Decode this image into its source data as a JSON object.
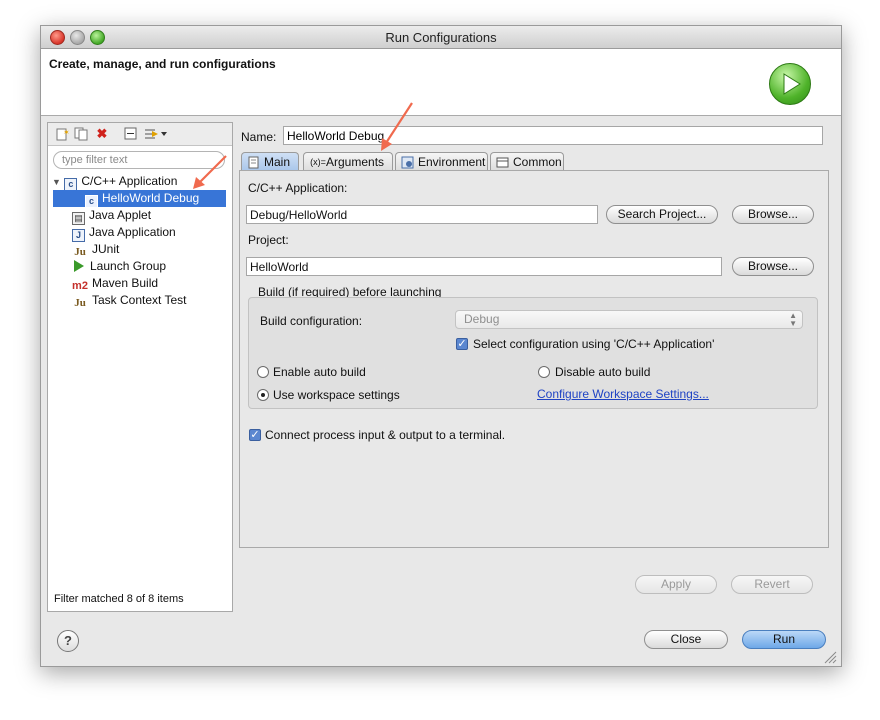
{
  "window": {
    "title": "Run Configurations"
  },
  "header": {
    "text": "Create, manage, and run configurations"
  },
  "left": {
    "filter_placeholder": "type filter text",
    "tree": [
      {
        "label": "C/C++ Application",
        "icon": "c-app-icon"
      },
      {
        "label": "HelloWorld Debug",
        "icon": "c-config-icon",
        "selected": true
      },
      {
        "label": "Java Applet",
        "icon": "java-applet-icon"
      },
      {
        "label": "Java Application",
        "icon": "java-app-icon"
      },
      {
        "label": "JUnit",
        "icon": "junit-icon"
      },
      {
        "label": "Launch Group",
        "icon": "launch-group-icon"
      },
      {
        "label": "Maven Build",
        "icon": "maven-icon"
      },
      {
        "label": "Task Context Test",
        "icon": "task-context-icon"
      }
    ],
    "footer": "Filter matched 8 of 8 items"
  },
  "config": {
    "name_label": "Name:",
    "name_value": "HelloWorld Debug",
    "tabs": [
      {
        "label": "Main",
        "active": true
      },
      {
        "label": "Arguments"
      },
      {
        "label": "Environment"
      },
      {
        "label": "Common"
      }
    ],
    "app_label": "C/C++ Application:",
    "app_value": "Debug/HelloWorld",
    "search_project": "Search Project...",
    "browse": "Browse...",
    "project_label": "Project:",
    "project_value": "HelloWorld",
    "build_group_label": "Build (if required) before launching",
    "build_config_label": "Build configuration:",
    "build_config_value": "Debug",
    "select_config_label": "Select configuration using 'C/C++ Application'",
    "select_config_checked": true,
    "enable_auto_build": "Enable auto build",
    "disable_auto_build": "Disable auto build",
    "use_workspace": "Use workspace settings",
    "build_mode": "workspace",
    "configure_workspace": "Configure Workspace Settings...",
    "connect_terminal": "Connect process input & output to a terminal.",
    "connect_terminal_checked": true,
    "apply": "Apply",
    "revert": "Revert"
  },
  "footer": {
    "close": "Close",
    "run": "Run",
    "help": "?"
  },
  "colors": {
    "accent": "#3875d7",
    "annotation": "#f06a4e"
  }
}
